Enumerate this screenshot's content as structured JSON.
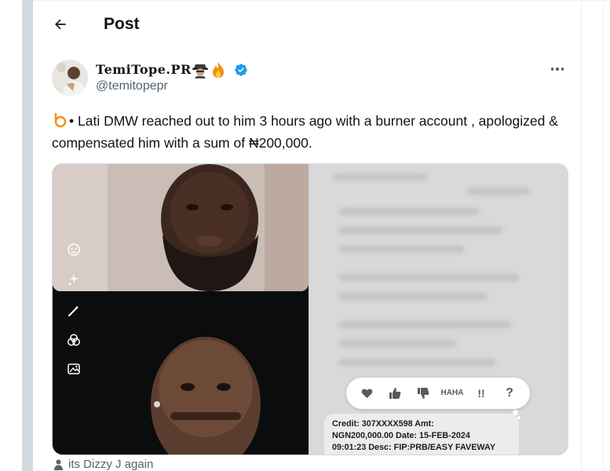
{
  "header": {
    "title": "Post",
    "back_icon": "arrow-left-icon"
  },
  "author": {
    "display_name": "TemiTope.PR",
    "emojis": [
      "detective-icon",
      "fire-icon"
    ],
    "verified": true,
    "handle": "@temitopepr"
  },
  "tweet": {
    "text": "• Lati DMW reached out to him 3 hours ago with a burner account , apologized & compensated him with a sum of ₦200,000."
  },
  "media": {
    "receipt_lines": [
      "Credit: 307XXXX598 Amt:",
      "NGN200,000.00 Date: 15-FEB-2024",
      "09:01:23 Desc: FIP:PRB/EASY FAVEWAY"
    ],
    "reactions": [
      "heart-icon",
      "thumbs-up-icon",
      "thumbs-down-icon",
      "HA HA",
      "!!",
      "?"
    ],
    "tools": [
      "face-filter-icon",
      "sparkles-icon",
      "magic-wand-icon",
      "blend-icon",
      "image-icon"
    ]
  },
  "quote_peek": {
    "text": "its Dizzy J again"
  },
  "colors": {
    "accent": "#1d9bf0",
    "text": "#0f1419",
    "secondary": "#536471"
  }
}
